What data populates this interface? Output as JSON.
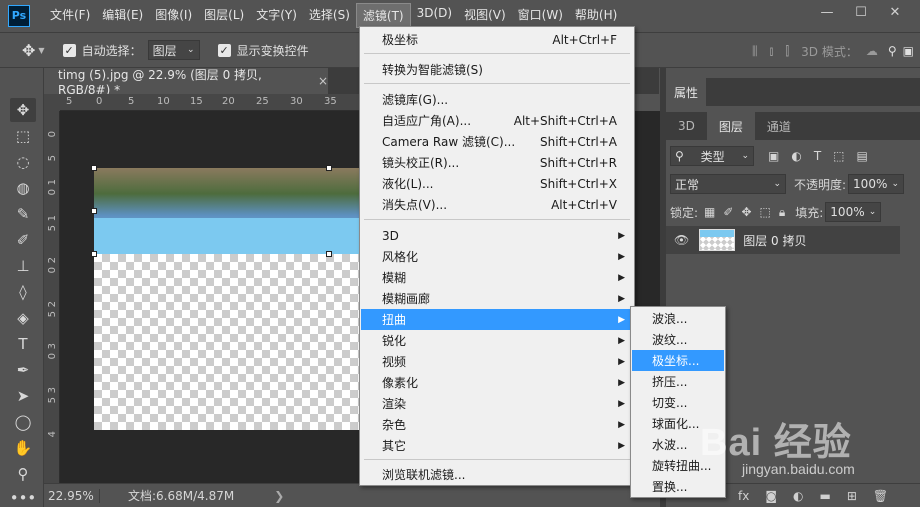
{
  "app": {
    "logo": "Ps"
  },
  "menubar": {
    "items": [
      "文件(F)",
      "编辑(E)",
      "图像(I)",
      "图层(L)",
      "文字(Y)",
      "选择(S)",
      "滤镜(T)",
      "3D(D)",
      "视图(V)",
      "窗口(W)",
      "帮助(H)"
    ],
    "active_index": 6
  },
  "window_controls": {
    "minimize": "—",
    "maximize": "☐",
    "close": "✕"
  },
  "options_bar": {
    "auto_select_label": "自动选择：",
    "auto_select_value": "图层",
    "show_transform_label": "显示变换控件",
    "mode_label": "3D 模式："
  },
  "document_tab": {
    "title": "timg (5).jpg @ 22.9% (图层 0 拷贝, RGB/8#) *",
    "close": "×"
  },
  "ruler": {
    "top_ticks": [
      "5",
      "0",
      "5",
      "10",
      "15",
      "20",
      "25",
      "30",
      "35"
    ],
    "left_ticks": [
      "0",
      "5",
      "1",
      "0",
      "1",
      "5",
      "2",
      "0",
      "2",
      "5",
      "3",
      "0",
      "3",
      "5",
      "4"
    ]
  },
  "status_bar": {
    "zoom": "22.95%",
    "doc_info": "文档:6.68M/4.87M",
    "arrow": "❯"
  },
  "panels": {
    "properties_tab": "属性",
    "tabs": [
      "3D",
      "图层",
      "通道"
    ],
    "active_tab": 1,
    "filter_type": "类型",
    "blend_mode": "正常",
    "opacity_label": "不透明度:",
    "opacity_value": "100%",
    "lock_label": "锁定:",
    "fill_label": "填充:",
    "fill_value": "100%",
    "layer_name": "图层 0 拷贝"
  },
  "filter_menu": {
    "items": [
      {
        "label": "极坐标",
        "shortcut": "Alt+Ctrl+F"
      },
      {
        "label": "转换为智能滤镜(S)",
        "shortcut": ""
      },
      {
        "label": "滤镜库(G)...",
        "shortcut": ""
      },
      {
        "label": "自适应广角(A)...",
        "shortcut": "Alt+Shift+Ctrl+A"
      },
      {
        "label": "Camera Raw 滤镜(C)...",
        "shortcut": "Shift+Ctrl+A"
      },
      {
        "label": "镜头校正(R)...",
        "shortcut": "Shift+Ctrl+R"
      },
      {
        "label": "液化(L)...",
        "shortcut": "Shift+Ctrl+X"
      },
      {
        "label": "消失点(V)...",
        "shortcut": "Alt+Ctrl+V"
      },
      {
        "label": "3D",
        "shortcut": ""
      },
      {
        "label": "风格化",
        "shortcut": ""
      },
      {
        "label": "模糊",
        "shortcut": ""
      },
      {
        "label": "模糊画廊",
        "shortcut": ""
      },
      {
        "label": "扭曲",
        "shortcut": ""
      },
      {
        "label": "锐化",
        "shortcut": ""
      },
      {
        "label": "视频",
        "shortcut": ""
      },
      {
        "label": "像素化",
        "shortcut": ""
      },
      {
        "label": "渲染",
        "shortcut": ""
      },
      {
        "label": "杂色",
        "shortcut": ""
      },
      {
        "label": "其它",
        "shortcut": ""
      },
      {
        "label": "浏览联机滤镜...",
        "shortcut": ""
      }
    ],
    "highlighted": "扭曲"
  },
  "distort_submenu": {
    "items": [
      "波浪...",
      "波纹...",
      "极坐标...",
      "挤压...",
      "切变...",
      "球面化...",
      "水波...",
      "旋转扭曲...",
      "置换..."
    ],
    "highlighted_index": 2
  },
  "watermark": {
    "logo_text": "Bai 经验",
    "url": "jingyan.baidu.com"
  }
}
